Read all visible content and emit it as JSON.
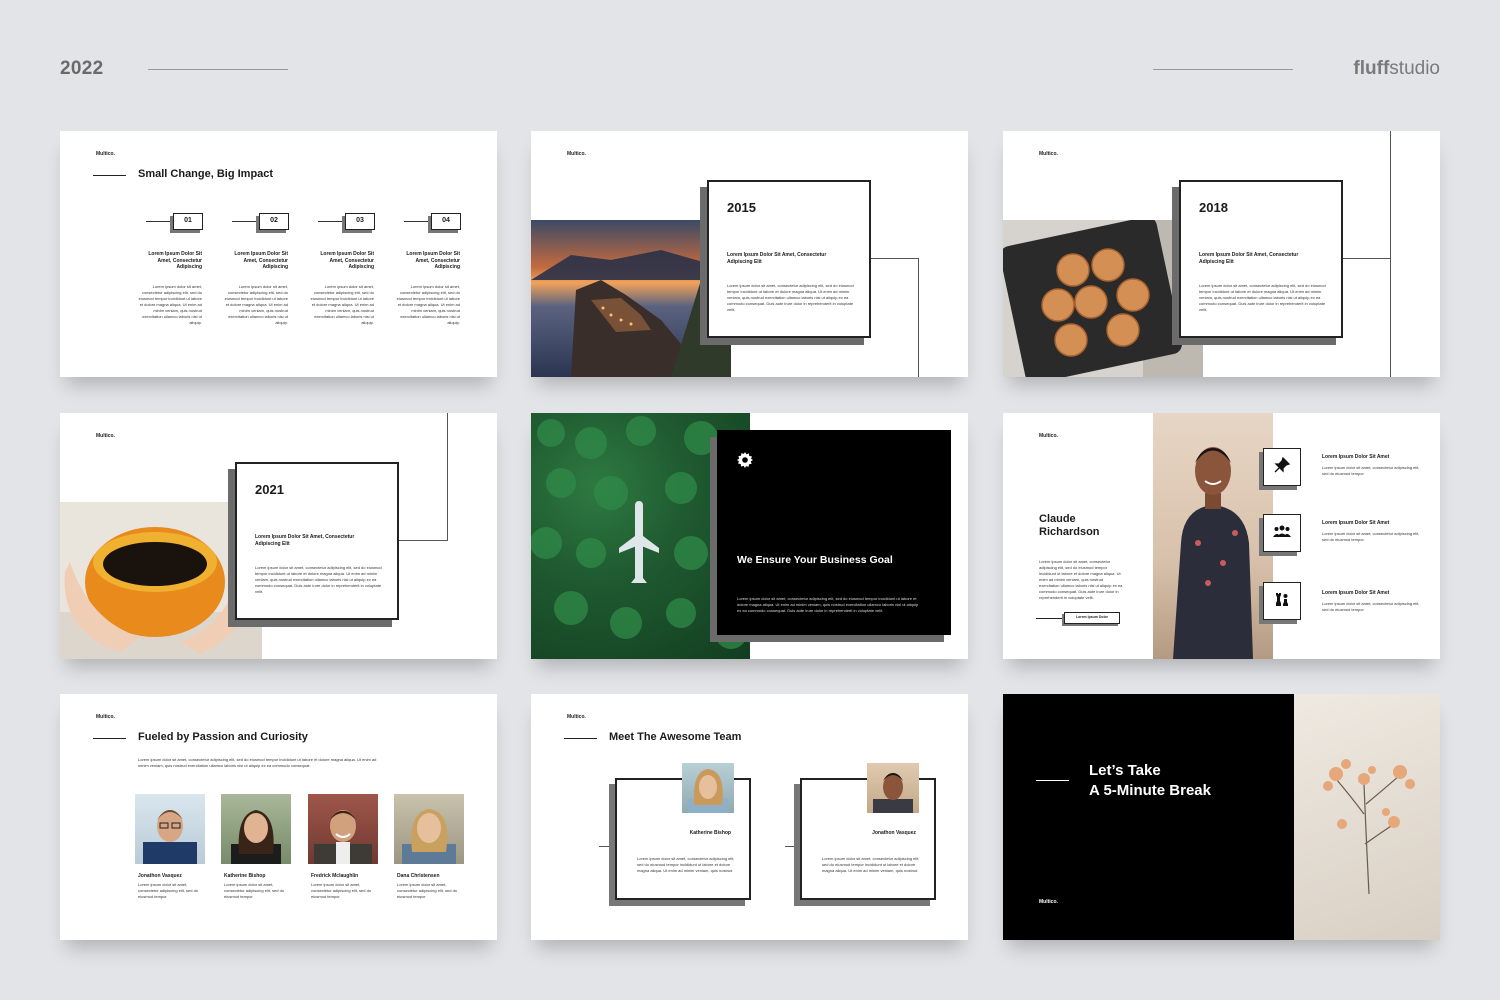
{
  "header": {
    "year": "2022",
    "brand_bold": "fluff",
    "brand_light": "studio"
  },
  "logo": "Multico.",
  "lorem_short": "Lorem ipsum dolor sit amet, consectetur adipiscing elit, sed do eiusmod tempor incididunt ut labore et dolore magna aliqua. Ut enim ad minim veniam, quis nostrud exercitation ullamco laboris nisi ut aliquip ex ea commodo consequat. Duis aute irure dolor in reprehenderit in voluptate velit.",
  "slide1": {
    "title": "Small Change, Big Impact",
    "steps": [
      {
        "num": "01",
        "title": "Lorem Ipsum Dolor Sit Amet, Consectetur Adipiscing",
        "body": "Lorem ipsum dolor sit amet, consectetur adipiscing elit, sed do eiusmod tempor incididunt ut labore et dolore magna aliqua. Ut enim ad minim veniam, quis nostrud exercitation ullamco laboris nisi ut aliquip."
      },
      {
        "num": "02",
        "title": "Lorem Ipsum Dolor Sit Amet, Consectetur Adipiscing",
        "body": "Lorem ipsum dolor sit amet, consectetur adipiscing elit, sed do eiusmod tempor incididunt ut labore et dolore magna aliqua. Ut enim ad minim veniam, quis nostrud exercitation ullamco laboris nisi ut aliquip."
      },
      {
        "num": "03",
        "title": "Lorem Ipsum Dolor Sit Amet, Consectetur Adipiscing",
        "body": "Lorem ipsum dolor sit amet, consectetur adipiscing elit, sed do eiusmod tempor incididunt ut labore et dolore magna aliqua. Ut enim ad minim veniam, quis nostrud exercitation ullamco laboris nisi ut aliquip."
      },
      {
        "num": "04",
        "title": "Lorem Ipsum Dolor Sit Amet, Consectetur Adipiscing",
        "body": "Lorem ipsum dolor sit amet, consectetur adipiscing elit, sed do eiusmod tempor incididunt ut labore et dolore magna aliqua. Ut enim ad minim veniam, quis nostrud exercitation ullamco laboris nisi ut aliquip."
      }
    ]
  },
  "slide2": {
    "year": "2015",
    "subtitle": "Lorem Ipsum Dolor Sit Amet, Consectetur Adipiscing Elit"
  },
  "slide3": {
    "year": "2018",
    "subtitle": "Lorem Ipsum Dolor Sit Amet, Consectetur Adipiscing Elit"
  },
  "slide4": {
    "year": "2021",
    "subtitle": "Lorem Ipsum Dolor Sit Amet, Consectetur Adipiscing Elit"
  },
  "slide5": {
    "title": "We Ensure Your Business Goal"
  },
  "slide6": {
    "name_line1": "Claude",
    "name_line2": "Richardson",
    "button": "Lorem Ipsum Dolor",
    "features": [
      {
        "icon": "pin-icon",
        "title": "Lorem Ipsum Dolor Sit Amet",
        "body": "Lorem ipsum dolor sit amet, consectetur adipiscing elit, sed do eiusmod tempor"
      },
      {
        "icon": "group-icon",
        "title": "Lorem Ipsum Dolor Sit Amet",
        "body": "Lorem ipsum dolor sit amet, consectetur adipiscing elit, sed do eiusmod tempor"
      },
      {
        "icon": "chess-icon",
        "title": "Lorem Ipsum Dolor Sit Amet",
        "body": "Lorem ipsum dolor sit amet, consectetur adipiscing elit, sed do eiusmod tempor"
      }
    ]
  },
  "slide7": {
    "title": "Fueled by Passion and Curiosity",
    "intro": "Lorem ipsum dolor sit amet, consectetur adipiscing elit, sed do eiusmod tempor incididunt ut labore et dolore magna aliqua. Ut enim ad minim veniam, quis nostrud exercitation ullamco laboris nisi ut aliquip ex ea commodo consequat.",
    "people": [
      {
        "name": "Jonathon Vasquez",
        "body": "Lorem ipsum dolor sit amet, consectetur adipiscing elit, sed do eiusmod tempor"
      },
      {
        "name": "Katherine Bishop",
        "body": "Lorem ipsum dolor sit amet, consectetur adipiscing elit, sed do eiusmod tempor"
      },
      {
        "name": "Fredrick Mclaughlin",
        "body": "Lorem ipsum dolor sit amet, consectetur adipiscing elit, sed do eiusmod tempor"
      },
      {
        "name": "Dana Christensen",
        "body": "Lorem ipsum dolor sit amet, consectetur adipiscing elit, sed do eiusmod tempor"
      }
    ]
  },
  "slide8": {
    "title": "Meet The Awesome Team",
    "members": [
      {
        "name": "Katherine Bishop",
        "body": "Lorem ipsum dolor sit amet, consectetur adipiscing elit, sed do eiusmod tempor incididunt ut labore et dolore magna aliqua. Ut enim ad minim veniam, quis nostrud"
      },
      {
        "name": "Jonathon Vasquez",
        "body": "Lorem ipsum dolor sit amet, consectetur adipiscing elit, sed do eiusmod tempor incididunt ut labore et dolore magna aliqua. Ut enim ad minim veniam, quis nostrud"
      }
    ]
  },
  "slide9": {
    "line1": "Let’s Take",
    "line2": "A 5-Minute Break"
  }
}
